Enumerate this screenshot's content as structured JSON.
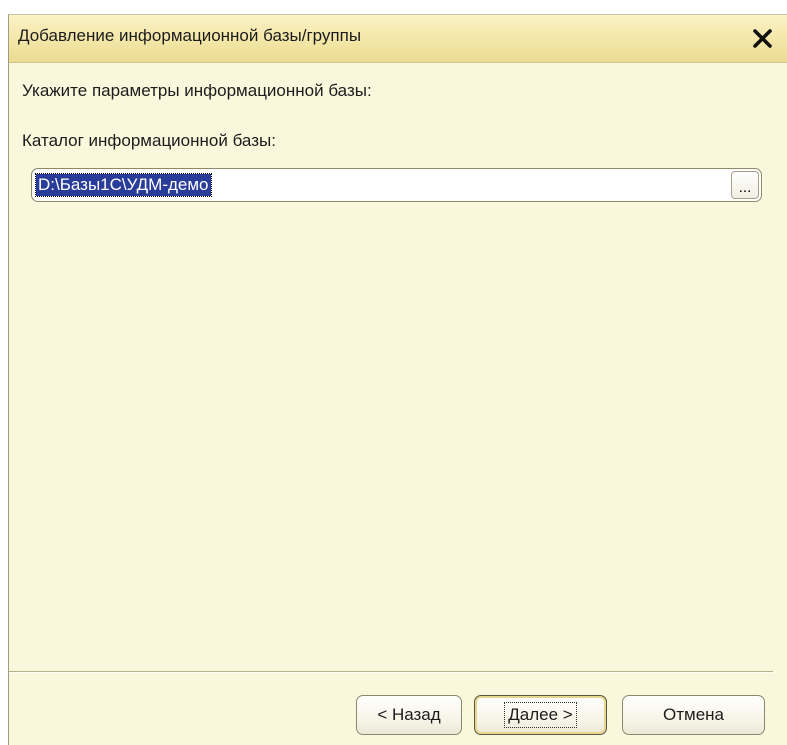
{
  "window": {
    "title": "Добавление информационной базы/группы",
    "close_glyph": "✕"
  },
  "form": {
    "prompt": "Укажите параметры информационной базы:",
    "catalog_label": "Каталог информационной базы:",
    "catalog_value": "D:\\Базы1С\\УДМ-демо",
    "browse_label": "..."
  },
  "buttons": {
    "back": "< Назад",
    "next": "Далее >",
    "cancel": "Отмена"
  },
  "icons": {
    "close": "close-icon"
  },
  "colors": {
    "window_bg": "#FAF8DC",
    "title_bg": "#F3E6A7",
    "selection": "#2A3C9A"
  }
}
